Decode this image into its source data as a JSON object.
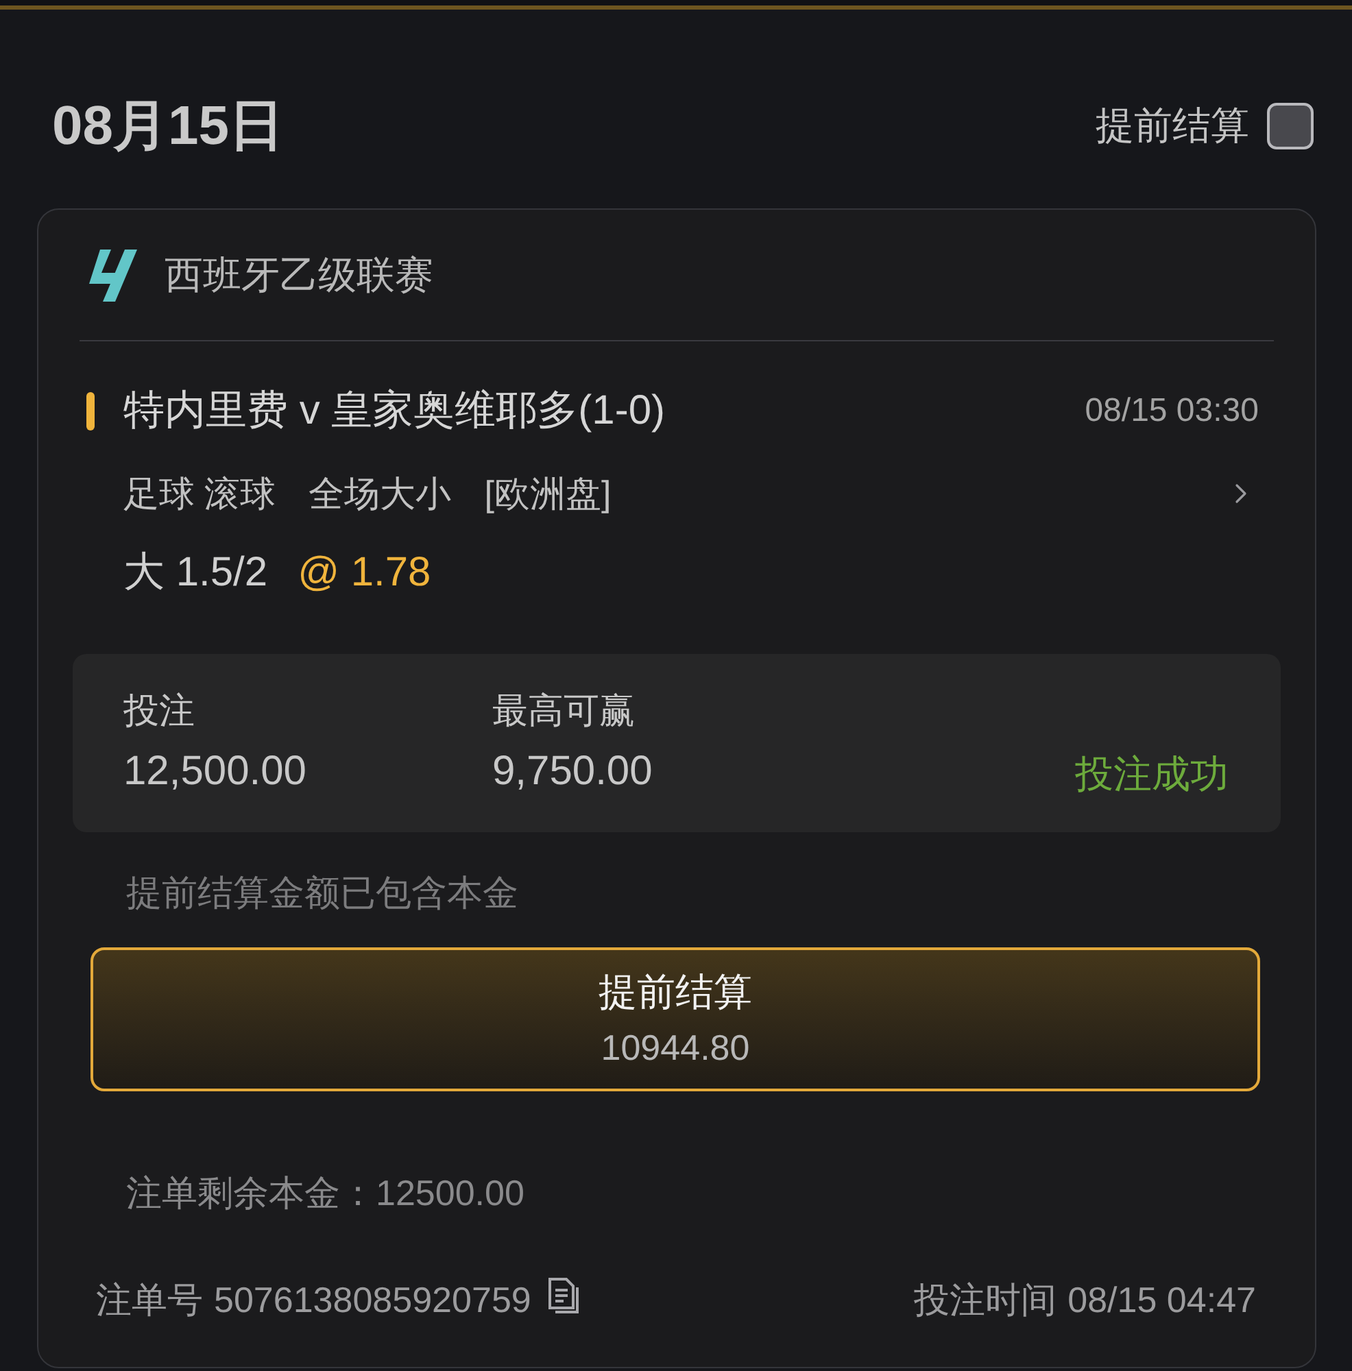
{
  "header": {
    "date": "08月15日",
    "early_settle_toggle": {
      "label": "提前结算",
      "checked": false
    }
  },
  "bet": {
    "league": {
      "name": "西班牙乙级联赛"
    },
    "match": {
      "title": "特内里费 v 皇家奥维耶多(1-0)",
      "time": "08/15 03:30"
    },
    "market": [
      "足球 滚球",
      "全场大小",
      "[欧洲盘]"
    ],
    "selection": {
      "pick": "大 1.5/2",
      "odds": "@ 1.78"
    },
    "stats": [
      {
        "label": "投注",
        "value": "12,500.00"
      },
      {
        "label": "最高可赢",
        "value": "9,750.00"
      }
    ],
    "status": {
      "text": "投注成功",
      "kind": "success"
    },
    "cashout_note": "提前结算金额已包含本金",
    "cashout_button": {
      "label": "提前结算",
      "amount": "10944.80"
    },
    "remaining_principal": "注单剩余本金：12500.00",
    "bet_number": {
      "label": "注单号",
      "value": "5076138085920759"
    },
    "bet_time": {
      "label": "投注时间",
      "value": "08/15 04:47"
    }
  }
}
